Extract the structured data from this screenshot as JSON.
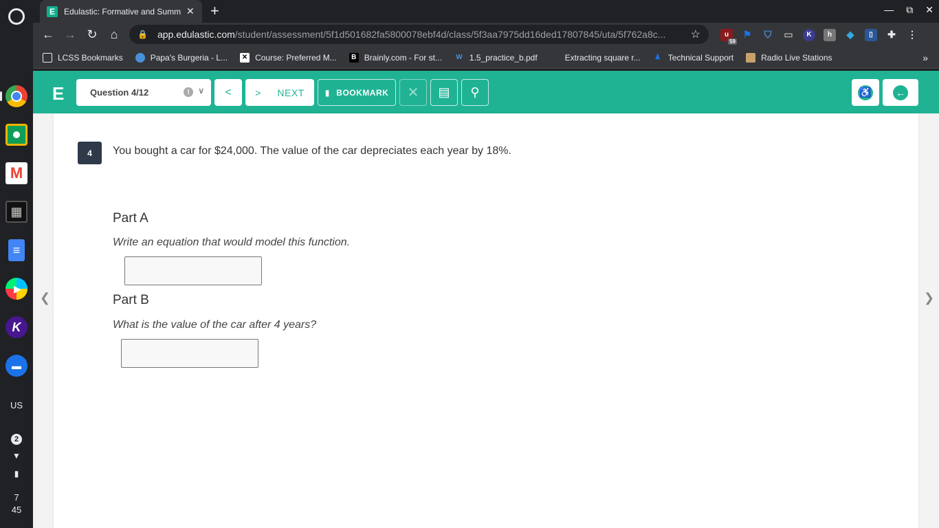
{
  "shelf": {
    "user_label": "US",
    "notification_count": "2",
    "time_hour": "7",
    "time_minute": "45"
  },
  "browser": {
    "tab_title": "Edulastic: Formative and Summ",
    "tab_favicon_text": "E",
    "url_domain": "app.edulastic.com",
    "url_path": "/student/assessment/5f1d501682fa5800078ebf4d/class/5f3aa7975dd16ded17807845/uta/5f762a8c...",
    "extension_badge": "59",
    "bookmarks": [
      {
        "label": "LCSS Bookmarks",
        "icon": "folder-icon",
        "color": "#e8eaed"
      },
      {
        "label": "Papa's Burgeria - L...",
        "icon": "globe-icon",
        "color": "#4a90d9"
      },
      {
        "label": "Course: Preferred M...",
        "icon": "x-logo-icon",
        "color": "#ffffff"
      },
      {
        "label": "Brainly.com - For st...",
        "icon": "brainly-icon",
        "color": "#000000"
      },
      {
        "label": "1.5_practice_b.pdf",
        "icon": "w-icon",
        "color": "#4a90d9"
      },
      {
        "label": "Extracting square r...",
        "icon": "page-icon",
        "color": "#35363a"
      },
      {
        "label": "Technical Support",
        "icon": "person-icon",
        "color": "#1a73e8"
      },
      {
        "label": "Radio Live Stations",
        "icon": "radio-icon",
        "color": "#c8a06a"
      }
    ]
  },
  "edulastic": {
    "logo": "E",
    "question_selector": "Question 4/12",
    "next_label": "NEXT",
    "bookmark_label": "BOOKMARK",
    "accent_color": "#1fb394"
  },
  "question": {
    "number": "4",
    "text": "You bought a car for $24,000. The value of the car depreciates each year by 18%.",
    "parts": [
      {
        "title": "Part A",
        "prompt": "Write an equation that would model this function.",
        "answer_value": ""
      },
      {
        "title": "Part B",
        "prompt": "What is the value of the car after 4 years?",
        "answer_value": ""
      }
    ]
  }
}
